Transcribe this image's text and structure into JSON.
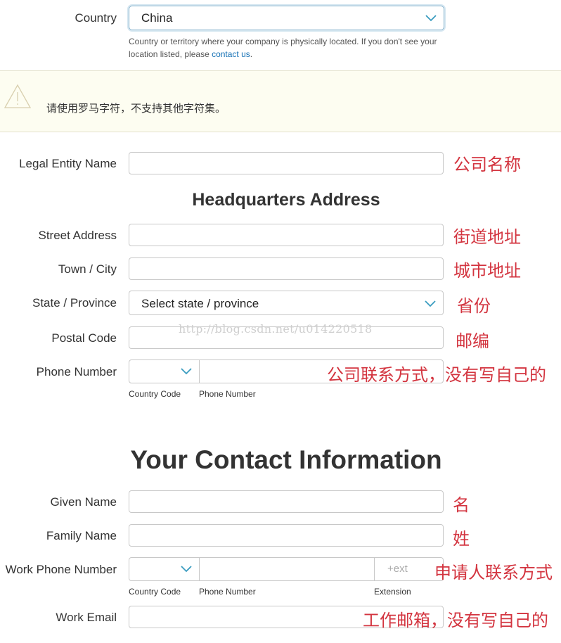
{
  "country": {
    "label": "Country",
    "value": "China",
    "helper_text": "Country or territory where your company is physically located. If you don't see your location listed, please ",
    "helper_link": "contact us",
    "helper_end": "."
  },
  "warning": {
    "icon": "warning-triangle-icon",
    "text": "请使用罗马字符，不支持其他字符集。"
  },
  "legal_entity": {
    "label": "Legal Entity Name",
    "value": "",
    "note": "公司名称"
  },
  "headquarters": {
    "title": "Headquarters Address",
    "street": {
      "label": "Street Address",
      "value": "",
      "note": "街道地址"
    },
    "city": {
      "label": "Town / City",
      "value": "",
      "note": "城市地址"
    },
    "state": {
      "label": "State / Province",
      "value": "Select state / province",
      "note": "省份"
    },
    "postal": {
      "label": "Postal Code",
      "value": "",
      "note": "邮编"
    },
    "phone": {
      "label": "Phone Number",
      "country_code_label": "Country Code",
      "number_label": "Phone Number",
      "note": "公司联系方式，没有写自己的"
    }
  },
  "contact": {
    "title": "Your Contact Information",
    "given_name": {
      "label": "Given Name",
      "value": "",
      "note": "名"
    },
    "family_name": {
      "label": "Family Name",
      "value": "",
      "note": "姓"
    },
    "work_phone": {
      "label": "Work Phone Number",
      "country_code_label": "Country Code",
      "number_label": "Phone Number",
      "extension_label": "Extension",
      "extension_placeholder": "+ext",
      "note": "申请人联系方式"
    },
    "work_email": {
      "label": "Work Email",
      "value": "",
      "note": "工作邮箱，没有写自己的"
    }
  },
  "watermark": "http://blog.csdn.net/u014220518",
  "colors": {
    "annotation_red": "#d3343f",
    "link_blue": "#1470b5",
    "chevron_blue": "#3a9cc0",
    "warning_bg": "#fdfdf1"
  }
}
